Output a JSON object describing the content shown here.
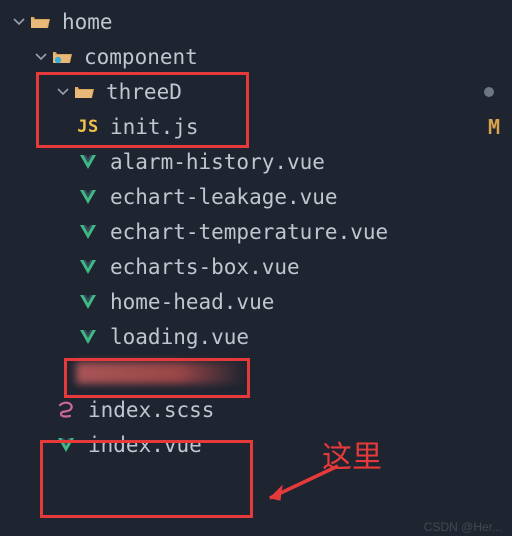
{
  "tree": {
    "home": "home",
    "component": "component",
    "threeD": "threeD",
    "initjs": "init.js",
    "alarm": "alarm-history.vue",
    "leakage": "echart-leakage.vue",
    "temperature": "echart-temperature.vue",
    "echartsbox": "echarts-box.vue",
    "homehead": "home-head.vue",
    "loading": "loading.vue",
    "indexscss": "index.scss",
    "indexvue": "index.vue"
  },
  "icons": {
    "js_badge": "JS"
  },
  "status": {
    "modified": "M"
  },
  "annotation": {
    "here": "这里"
  },
  "watermark": "CSDN @Her..."
}
